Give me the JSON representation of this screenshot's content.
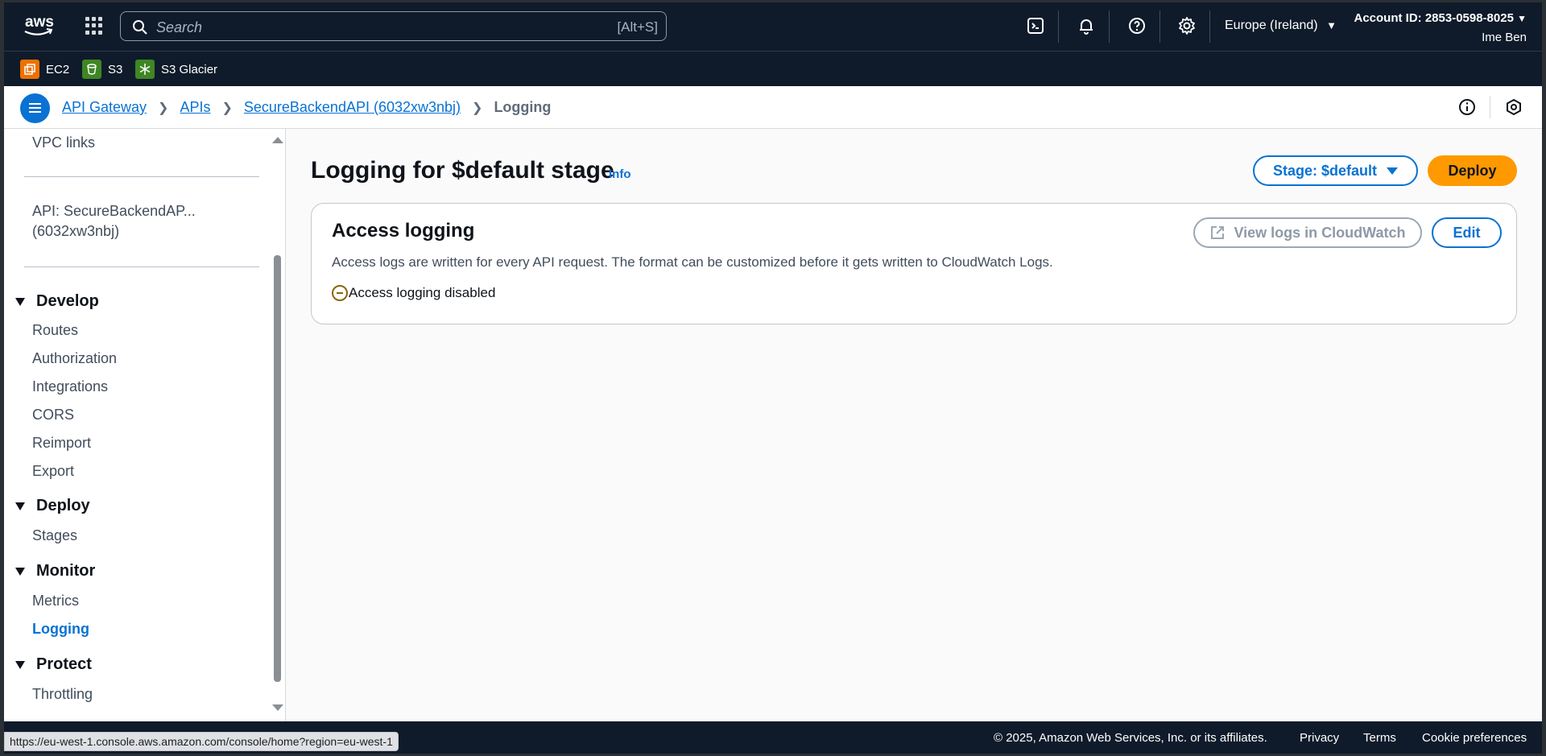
{
  "topnav": {
    "logo_text": "aws",
    "search_placeholder": "Search",
    "search_shortcut": "[Alt+S]",
    "region": "Europe (Ireland)",
    "account_id": "Account ID: 2853-0598-8025",
    "user": "Ime Ben"
  },
  "favorites": [
    {
      "label": "EC2",
      "color": "#ed7100"
    },
    {
      "label": "S3",
      "color": "#3f8624"
    },
    {
      "label": "S3 Glacier",
      "color": "#3f8624"
    }
  ],
  "breadcrumb": {
    "items": [
      "API Gateway",
      "APIs",
      "SecureBackendAPI (6032xw3nbj)"
    ],
    "current": "Logging"
  },
  "sidebar": {
    "vpc_links": "VPC links",
    "api_line1": "API: SecureBackendAP...",
    "api_line2": "(6032xw3nbj)",
    "develop": {
      "title": "Develop",
      "items": [
        "Routes",
        "Authorization",
        "Integrations",
        "CORS",
        "Reimport",
        "Export"
      ]
    },
    "deploy": {
      "title": "Deploy",
      "items": [
        "Stages"
      ]
    },
    "monitor": {
      "title": "Monitor",
      "items": [
        "Metrics",
        "Logging"
      ]
    },
    "protect": {
      "title": "Protect",
      "items": [
        "Throttling"
      ]
    }
  },
  "main": {
    "title": "Logging for $default stage",
    "info": "Info",
    "stage_button": "Stage: $default",
    "deploy_button": "Deploy",
    "card": {
      "title": "Access logging",
      "description": "Access logs are written for every API request. The format can be customized before it gets written to CloudWatch Logs.",
      "status": "Access logging disabled",
      "view_logs_button": "View logs in CloudWatch",
      "edit_button": "Edit"
    }
  },
  "footer": {
    "copyright": "© 2025, Amazon Web Services, Inc. or its affiliates.",
    "privacy": "Privacy",
    "terms": "Terms",
    "cookies": "Cookie preferences"
  },
  "status_url": "https://eu-west-1.console.aws.amazon.com/console/home?region=eu-west-1",
  "colors": {
    "accent": "#0972d3",
    "deploy": "#ff9900",
    "nav_bg": "#0f1b2a"
  }
}
